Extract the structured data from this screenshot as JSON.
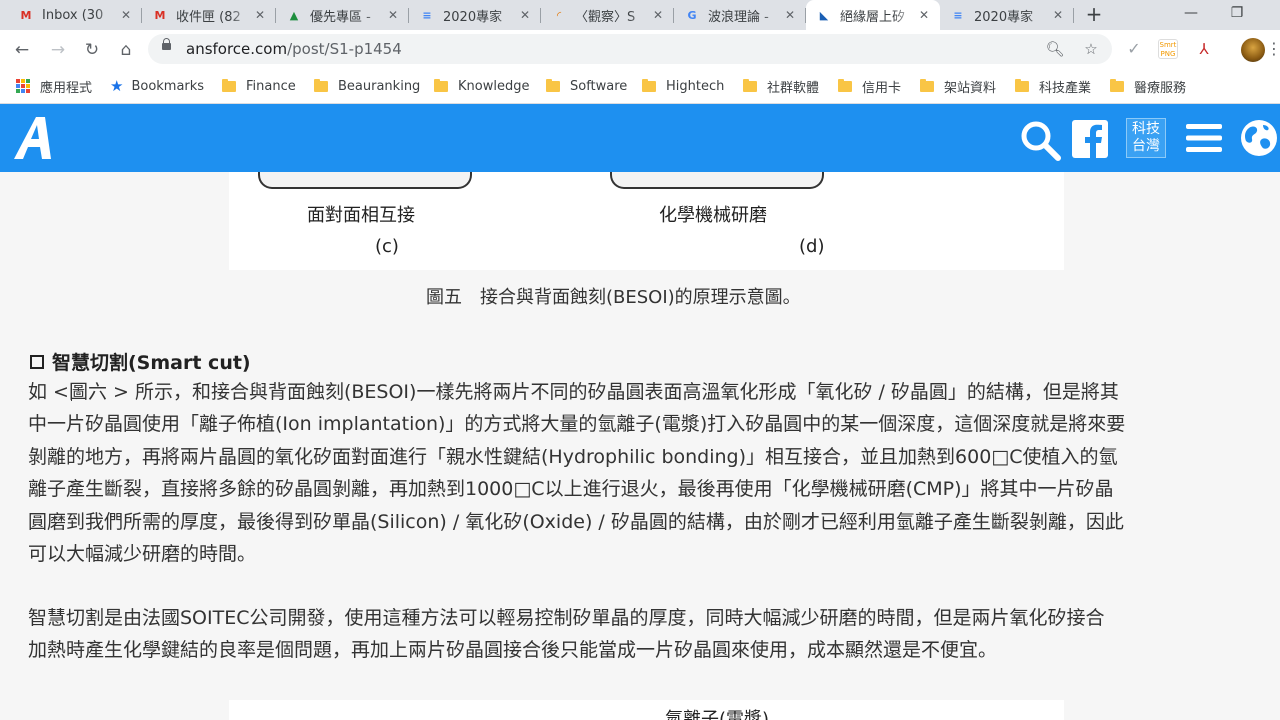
{
  "browser": {
    "tabs": [
      {
        "title": "Inbox (30",
        "icon": "gmail-icon",
        "glyph": "M",
        "color": "#d93025"
      },
      {
        "title": "收件匣 (82",
        "icon": "gmail-icon",
        "glyph": "M",
        "color": "#d93025"
      },
      {
        "title": "優先專區 -",
        "icon": "google-drive-icon",
        "glyph": "▲",
        "color": "#1e8e3e"
      },
      {
        "title": "2020專家",
        "icon": "google-docs-icon",
        "glyph": "≡",
        "color": "#4285f4"
      },
      {
        "title": "〈觀察〉S",
        "icon": "rainbow-icon",
        "glyph": "◜",
        "color": "#e37400"
      },
      {
        "title": "波浪理論 -",
        "icon": "google-icon",
        "glyph": "G",
        "color": "#4285f4"
      },
      {
        "title": "絕緣層上矽",
        "icon": "rss-icon",
        "glyph": "◣",
        "color": "#1a5fb4",
        "active": true
      },
      {
        "title": "2020專家",
        "icon": "google-docs-icon",
        "glyph": "≡",
        "color": "#4285f4"
      }
    ],
    "new_tab": "+",
    "url_host": "ansforce.com",
    "url_path": "/post/S1-p1454",
    "bookmarks": [
      {
        "label": "應用程式",
        "type": "apps"
      },
      {
        "label": "Bookmarks",
        "type": "star"
      },
      {
        "label": "Finance",
        "type": "folder"
      },
      {
        "label": "Beauranking",
        "type": "folder"
      },
      {
        "label": "Knowledge",
        "type": "folder"
      },
      {
        "label": "Software",
        "type": "folder"
      },
      {
        "label": "Hightech",
        "type": "folder"
      },
      {
        "label": "社群軟體",
        "type": "folder"
      },
      {
        "label": "信用卡",
        "type": "folder"
      },
      {
        "label": "架站資料",
        "type": "folder"
      },
      {
        "label": "科技產業",
        "type": "folder"
      },
      {
        "label": "醫療服務",
        "type": "folder"
      }
    ]
  },
  "site": {
    "header_color": "#1e90f0",
    "region_button_line1": "科技",
    "region_button_line2": "台灣"
  },
  "article": {
    "figure_labels": {
      "c_text": "面對面相互接",
      "c_letter": "(c)",
      "d_text": "化學機械研磨",
      "d_letter": "(d)"
    },
    "figure_caption": "圖五　接合與背面蝕刻(BESOI)的原理示意圖。",
    "section_title": "智慧切割(Smart cut)",
    "paragraph1": [
      "如 <圖六 > 所示，和接合與背面蝕刻(BESOI)一樣先將兩片不同的矽晶圓表面高溫氧化形成「氧化矽 / 矽晶圓」的結構，但是將其",
      "中一片矽晶圓使用「離子佈植(Ion implantation)」的方式將大量的氫離子(電漿)打入矽晶圓中的某一個深度，這個深度就是將來要",
      "剝離的地方，再將兩片晶圓的氧化矽面對面進行「親水性鍵結(Hydrophilic bonding)」相互接合，並且加熱到600□C使植入的氫",
      "離子產生斷裂，直接將多餘的矽晶圓剝離，再加熱到1000□C以上進行退火，最後再使用「化學機械研磨(CMP)」將其中一片矽晶",
      "圓磨到我們所需的厚度，最後得到矽單晶(Silicon) / 氧化矽(Oxide) / 矽晶圓的結構，由於剛才已經利用氫離子產生斷裂剝離，因此",
      "可以大幅減少研磨的時間。"
    ],
    "paragraph2": [
      "智慧切割是由法國SOITEC公司開發，使用這種方法可以輕易控制矽單晶的厚度，同時大幅減少研磨的時間，但是兩片氧化矽接合",
      "加熱時產生化學鍵結的良率是個問題，再加上兩片矽晶圓接合後只能當成一片矽晶圓來使用，成本顯然還是不便宜。"
    ],
    "next_figure_label": "氫離子(電漿)"
  }
}
